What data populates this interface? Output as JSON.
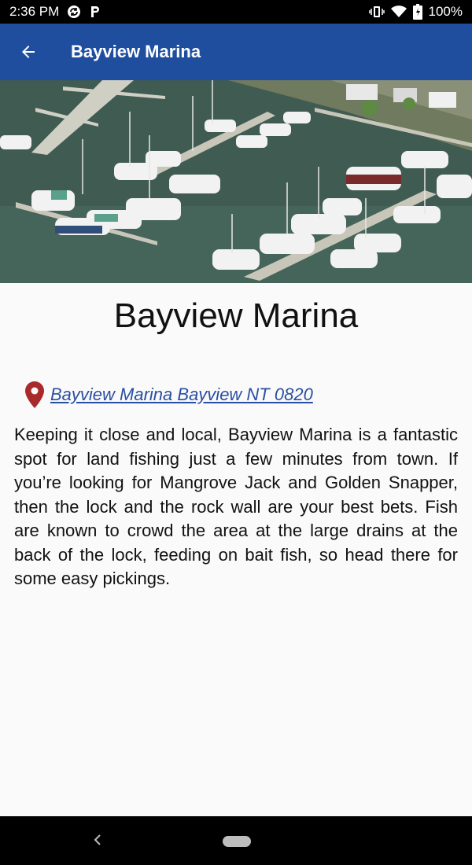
{
  "status_bar": {
    "time": "2:36 PM",
    "battery": "100%",
    "icons": [
      "sync-icon",
      "parking-icon",
      "vibrate-icon",
      "wifi-icon",
      "battery-icon"
    ]
  },
  "app_bar": {
    "title": "Bayview Marina",
    "back_icon": "arrow-left-icon",
    "color": "#1f4e9f"
  },
  "place": {
    "title": "Bayview Marina",
    "address": "Bayview Marina Bayview NT 0820",
    "address_icon": "map-pin-icon",
    "pin_color": "#a82a2a",
    "description": "Keeping it close and local, Bayview Marina is a fantastic spot for land fishing just a few minutes from town. If you’re looking for Mangrove Jack and Golden Snapper, then the lock and the rock wall are your best bets. Fish are known to crowd the area at the large drains at the back of the lock, feeding on bait fish, so head there for some easy pickings."
  },
  "nav_bar": {
    "back_icon": "nav-back-icon",
    "home_icon": "nav-home-pill"
  }
}
